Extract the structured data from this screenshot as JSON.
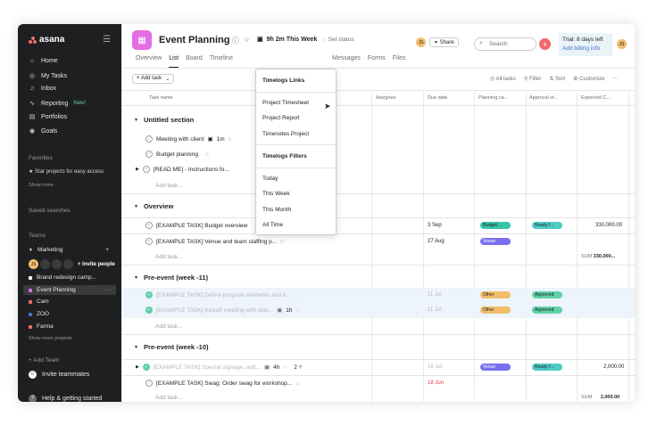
{
  "app": {
    "logo_text": "asana"
  },
  "sidebar": {
    "nav": [
      {
        "label": "Home",
        "icon": "home-icon",
        "glyph": "⌂"
      },
      {
        "label": "My Tasks",
        "icon": "check-circle-icon",
        "glyph": "◎"
      },
      {
        "label": "Inbox",
        "icon": "bell-icon",
        "glyph": "♫"
      },
      {
        "label": "Reporting",
        "badge": "New!",
        "icon": "chart-icon",
        "glyph": "∿"
      },
      {
        "label": "Portfolios",
        "icon": "portfolio-icon",
        "glyph": "▤"
      },
      {
        "label": "Goals",
        "icon": "goal-icon",
        "glyph": "◉"
      }
    ],
    "favorites_label": "Favorites",
    "favorites_hint": "★ Star projects for easy access",
    "show_more": "Show more",
    "saved_searches": "Saved searches",
    "teams_label": "Teams",
    "team_name": "Marketing",
    "invite_people": "+ Invite people",
    "avatar_initials": "JS",
    "projects": [
      {
        "name": "Brand redesign camp...",
        "color": "#ffffff"
      },
      {
        "name": "Event Planning",
        "color": "#e36de3",
        "active": true
      },
      {
        "name": "Cam",
        "color": "#f06a6a"
      },
      {
        "name": "ZOO",
        "color": "#4573d2"
      },
      {
        "name": "Farma",
        "color": "#f06a6a"
      }
    ],
    "show_more_projects": "Show more projects",
    "add_team": "+ Add Team",
    "invite_teammates": "Invite teammates",
    "help": "Help & getting started"
  },
  "header": {
    "project_title": "Event Planning",
    "timer": "9h 2m This Week",
    "set_status": "Set status",
    "share": "Share",
    "search_placeholder": "Search",
    "trial_text": "Trial: 8 days left",
    "add_billing": "Add billing info",
    "user_initials": "JS",
    "member_initials": "JS"
  },
  "tabs": {
    "items": [
      "Overview",
      "List",
      "Board",
      "Timeline"
    ],
    "items_right": [
      "Messages",
      "Forms",
      "Files"
    ],
    "active": "List"
  },
  "toolbar": {
    "add_task": "+ Add task",
    "all_tasks": "All tasks",
    "filter": "Filter",
    "sort": "Sort",
    "customize": "Customize"
  },
  "columns": [
    "Task name",
    "Assignee",
    "Due date",
    "Planning ca...",
    "Approval st...",
    "Expected C..."
  ],
  "sections": [
    {
      "name": "Untitled section",
      "tasks": [
        {
          "name": "Meeting with client",
          "extra": "1m"
        },
        {
          "name": "Budget planning",
          "extra": ""
        },
        {
          "name": "[READ ME] - Instructions fo...",
          "extra": ""
        }
      ]
    },
    {
      "name": "Overview",
      "tasks": [
        {
          "name": "[EXAMPLE TASK] Budget overview",
          "due": "3 Sep",
          "planning": "Budget...",
          "approval": "Ready f...",
          "expected": "330,000.00"
        },
        {
          "name": "[EXAMPLE TASK] Venue and team staffing p...",
          "due": "27 Aug",
          "planning": "Venue"
        }
      ],
      "sum_label": "SUM",
      "sum_value": "330,000..."
    },
    {
      "name": "Pre-event (week -11)",
      "tasks": [
        {
          "name": "[EXAMPLE TASK] Define program elements and b...",
          "due": "11 Jul",
          "planning": "Other",
          "approval": "Approved"
        },
        {
          "name": "[EXAMPLE TASK] Kickoff meeting with stak...",
          "extra": "1h",
          "due": "11 Jul",
          "planning": "Other",
          "approval": "Approved"
        }
      ]
    },
    {
      "name": "Pre-event (week -10)",
      "tasks": [
        {
          "name": "[EXAMPLE TASK] Special signage, add...",
          "extra": "4h",
          "subtasks": "2",
          "due": "16 Jul",
          "planning": "Venue",
          "approval": "Ready f...",
          "expected": "2,000.00"
        },
        {
          "name": "[EXAMPLE TASK] Swag: Order swag for workshop...",
          "due": "18 Jun"
        }
      ],
      "sum_label": "SUM",
      "sum_value": "2,000.00"
    }
  ],
  "add_task_row": "Add task...",
  "dropdown": {
    "header1": "Timelogs Links",
    "links": [
      "Project Timesheet",
      "Project Report",
      "Timenotes Project"
    ],
    "header2": "Timelogs Filters",
    "filters": [
      "Today",
      "This Week",
      "This Month",
      "All Time"
    ]
  },
  "colors": {
    "sidebar_bg": "#1e1f21",
    "accent_red": "#f06a6a",
    "project_pink": "#e36de3",
    "pill_teal": "#37c5ab",
    "pill_purple": "#7a6ff0",
    "pill_orange": "#f1bd6c",
    "pill_green": "#5fd1a8",
    "pill_blue": "#4ecbc4"
  }
}
